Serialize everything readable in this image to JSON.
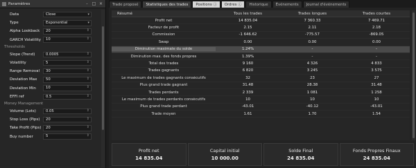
{
  "left_panel": {
    "title": "Paramètres",
    "controls": [
      "-",
      "□",
      "×"
    ],
    "sections": [
      {
        "label": "",
        "rows": [
          {
            "label": "Data",
            "value": "Close",
            "kind": "dropdown"
          },
          {
            "label": "Type",
            "value": "Exponential",
            "kind": "dropdown"
          },
          {
            "label": "Alpha Lookback",
            "value": "20",
            "kind": "number"
          },
          {
            "label": "GARCH Volatility",
            "value": "10",
            "kind": "number"
          }
        ]
      },
      {
        "label": "Thresholds",
        "rows": [
          {
            "label": "Slope (Trend)",
            "value": "0.0005",
            "kind": "number"
          },
          {
            "label": "Volatility",
            "value": "5",
            "kind": "number"
          },
          {
            "label": "Range Removal",
            "value": "30",
            "kind": "number"
          },
          {
            "label": "Deviation Max",
            "value": "50",
            "kind": "number"
          },
          {
            "label": "Deviation Min",
            "value": "10",
            "kind": "number"
          },
          {
            "label": "EFFI ref",
            "value": "0.5",
            "kind": "number"
          }
        ]
      },
      {
        "label": "Money Management",
        "rows": [
          {
            "label": "Volume (Lots)",
            "value": "0.05",
            "kind": "number"
          },
          {
            "label": "Stop Loss (Pips)",
            "value": "20",
            "kind": "number"
          },
          {
            "label": "Take Profit (Pips)",
            "value": "20",
            "kind": "number"
          },
          {
            "label": "Buy number",
            "value": "5",
            "kind": "number"
          }
        ]
      }
    ]
  },
  "tabs": [
    {
      "label": "Trade proposé",
      "active": false,
      "lite": false
    },
    {
      "label": "Statistiques des trades",
      "active": true,
      "lite": false
    },
    {
      "label": "Positions ⓘ",
      "active": false,
      "lite": true
    },
    {
      "label": "Ordres ⓘ",
      "active": false,
      "lite": true
    },
    {
      "label": "Historique",
      "active": false,
      "lite": false
    },
    {
      "label": "Événements",
      "active": false,
      "lite": false
    },
    {
      "label": "Journal d'événements",
      "active": false,
      "lite": false
    }
  ],
  "stats_table": {
    "headers": [
      "Résumé",
      "Tous les trades",
      "Trades longues",
      "Trades courtes"
    ],
    "rows": [
      {
        "label": "Profit net",
        "values": [
          "14 835.04",
          "7 360.33",
          "7 469.71"
        ],
        "highlight": false
      },
      {
        "label": "Facteur de profit",
        "values": [
          "2.15",
          "2.11",
          "2.18"
        ],
        "highlight": false
      },
      {
        "label": "Commission",
        "values": [
          "-1 646.62",
          "-775.57",
          "-869.05"
        ],
        "highlight": false
      },
      {
        "label": "Swap",
        "values": [
          "0.00",
          "0.00",
          "0.00"
        ],
        "highlight": false
      },
      {
        "label": "Diminution maximale du solde",
        "values": [
          "1.24%",
          "-",
          "-"
        ],
        "highlight": true
      },
      {
        "label": "Diminution max. des fonds propres",
        "values": [
          "1.39%",
          "-",
          "-"
        ],
        "highlight": false
      },
      {
        "label": "Total des trades",
        "values": [
          "9 160",
          "4 326",
          "4 833"
        ],
        "highlight": false
      },
      {
        "label": "Trades gagnants",
        "values": [
          "6 820",
          "3 245",
          "3 575"
        ],
        "highlight": false
      },
      {
        "label": "Le maximum de trades gagnants consécutifs",
        "values": [
          "32",
          "23",
          "27"
        ],
        "highlight": false
      },
      {
        "label": "Plus grand trade gagnant",
        "values": [
          "31.48",
          "28.38",
          "31.48"
        ],
        "highlight": false
      },
      {
        "label": "Trades perdants",
        "values": [
          "2 339",
          "1 081",
          "1 258"
        ],
        "highlight": false
      },
      {
        "label": "Le maximum de trades perdants consécutifs",
        "values": [
          "10",
          "10",
          "10"
        ],
        "highlight": false
      },
      {
        "label": "Plus grand trade perdant",
        "values": [
          "-43.01",
          "-40.12",
          "-43.01"
        ],
        "highlight": false
      },
      {
        "label": "Trade moyen",
        "values": [
          "1.61",
          "1.70",
          "1.54"
        ],
        "highlight": false
      }
    ]
  },
  "summary_cards": [
    {
      "title": "Profit net",
      "value": "14 835.04"
    },
    {
      "title": "Capital initial",
      "value": "10 000.00"
    },
    {
      "title": "Solde Final",
      "value": "24 835.04"
    },
    {
      "title": "Fonds Propres Finaux",
      "value": "24 835.04"
    }
  ]
}
